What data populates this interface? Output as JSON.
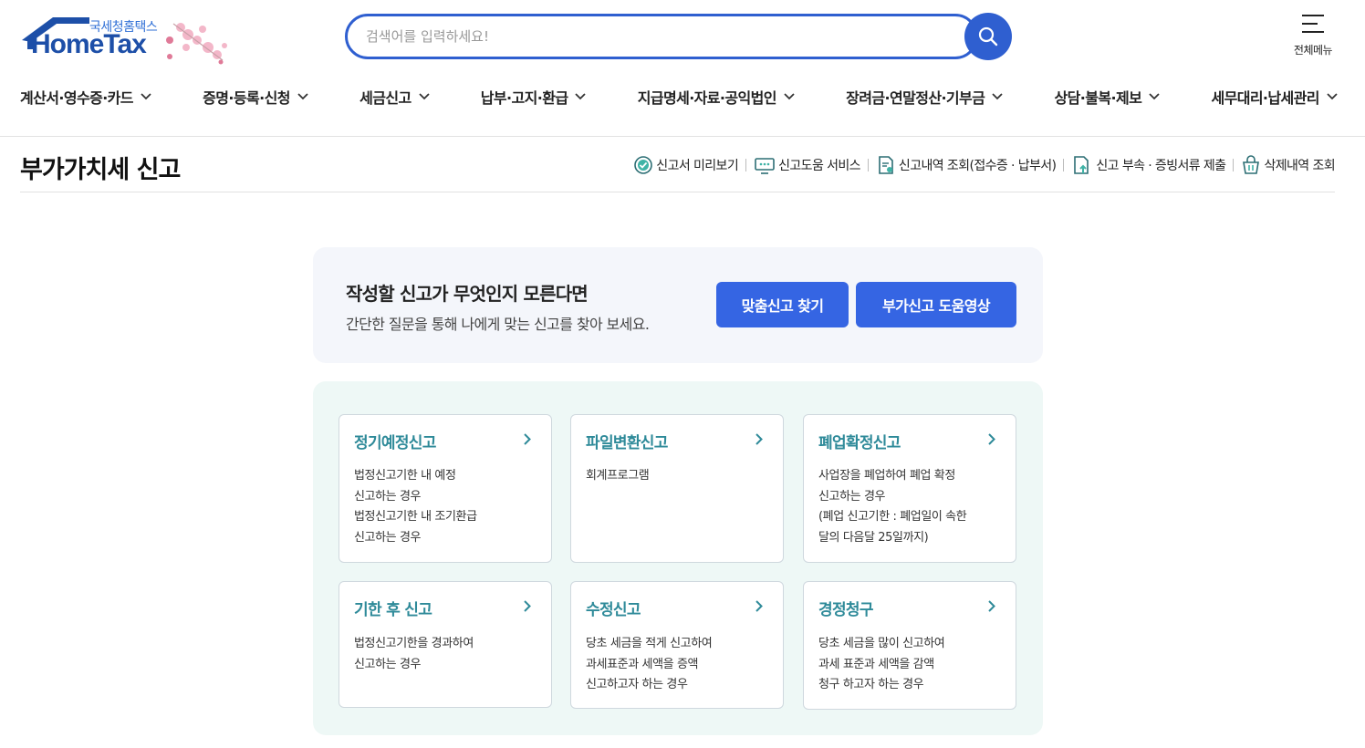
{
  "header": {
    "logo_sub": "국세청홈택스",
    "logo_main": "HomeTax",
    "search_placeholder": "검색어를 입력하세요!",
    "all_menu_label": "전체메뉴"
  },
  "gnb": [
    {
      "label": "계산서·영수증·카드"
    },
    {
      "label": "증명·등록·신청"
    },
    {
      "label": "세금신고"
    },
    {
      "label": "납부·고지·환급"
    },
    {
      "label": "지급명세·자료·공익법인"
    },
    {
      "label": "장려금·연말정산·기부금"
    },
    {
      "label": "상담·불복·제보"
    },
    {
      "label": "세무대리·납세관리"
    }
  ],
  "page": {
    "title": "부가가치세 신고",
    "tools": [
      {
        "label": "신고서 미리보기",
        "icon": "check-circle-icon"
      },
      {
        "label": "신고도움 서비스",
        "icon": "monitor-icon"
      },
      {
        "label": "신고내역 조회(접수증 · 납부서)",
        "icon": "document-search-icon"
      },
      {
        "label": "신고 부속 · 증빙서류 제출",
        "icon": "document-upload-icon"
      },
      {
        "label": "삭제내역 조회",
        "icon": "basket-icon"
      }
    ]
  },
  "help": {
    "title": "작성할 신고가 무엇인지 모른다면",
    "desc": "간단한 질문을 통해 나에게 맞는 신고를 찾아 보세요.",
    "btn_find": "맞춤신고 찾기",
    "btn_video": "부가신고 도움영상"
  },
  "cards": [
    {
      "title": "정기예정신고",
      "lines": [
        "법정신고기한 내 예정",
        "신고하는 경우",
        "법정신고기한 내 조기환급",
        "신고하는 경우"
      ]
    },
    {
      "title": "파일변환신고",
      "lines": [
        "회계프로그램"
      ]
    },
    {
      "title": "폐업확정신고",
      "lines": [
        "사업장을 폐업하여 폐업 확정",
        "신고하는 경우",
        "(폐업 신고기한 : 폐업일이 속한",
        "달의 다음달 25일까지)"
      ]
    },
    {
      "title": "기한 후 신고",
      "lines": [
        "법정신고기한을 경과하여",
        "신고하는 경우"
      ]
    },
    {
      "title": "수정신고",
      "lines": [
        "당초 세금을 적게 신고하여",
        "과세표준과 세액을 증액",
        "신고하고자 하는 경우"
      ]
    },
    {
      "title": "경정청구",
      "lines": [
        "당초 세금을 많이 신고하여",
        "과세 표준과 세액을 감액",
        "청구 하고자 하는 경우"
      ]
    }
  ],
  "colors": {
    "brand_blue": "#2f5fd0",
    "button_blue": "#3565e3",
    "card_title": "#2e8a99",
    "cards_bg": "#eef8f6",
    "help_bg": "#f4f6fb"
  }
}
